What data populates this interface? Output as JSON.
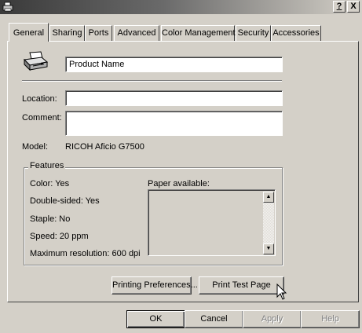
{
  "window": {
    "title": "",
    "help_label": "?",
    "close_label": "X"
  },
  "tabs": [
    {
      "label": "General",
      "active": true
    },
    {
      "label": "Sharing"
    },
    {
      "label": "Ports"
    },
    {
      "label": "Advanced"
    },
    {
      "label": "Color Management"
    },
    {
      "label": "Security"
    },
    {
      "label": "Accessories"
    }
  ],
  "general": {
    "printer_name": "Product Name",
    "location_label": "Location:",
    "location_value": "",
    "comment_label": "Comment:",
    "comment_value": "",
    "model_label": "Model:",
    "model_value": "RICOH Aficio G7500"
  },
  "features": {
    "title": "Features",
    "color": "Color: Yes",
    "double_sided": "Double-sided: Yes",
    "staple": "Staple: No",
    "speed": "Speed: 20 ppm",
    "max_resolution": "Maximum resolution: 600 dpi",
    "paper_label": "Paper available:",
    "paper_items": []
  },
  "buttons": {
    "preferences": "Printing Preferences...",
    "test_page": "Print Test Page",
    "ok": "OK",
    "cancel": "Cancel",
    "apply": "Apply",
    "help": "Help"
  },
  "colors": {
    "face": "#d4d0c8",
    "shadow": "#808080",
    "titlebar_dark": "#3a3a3a"
  }
}
